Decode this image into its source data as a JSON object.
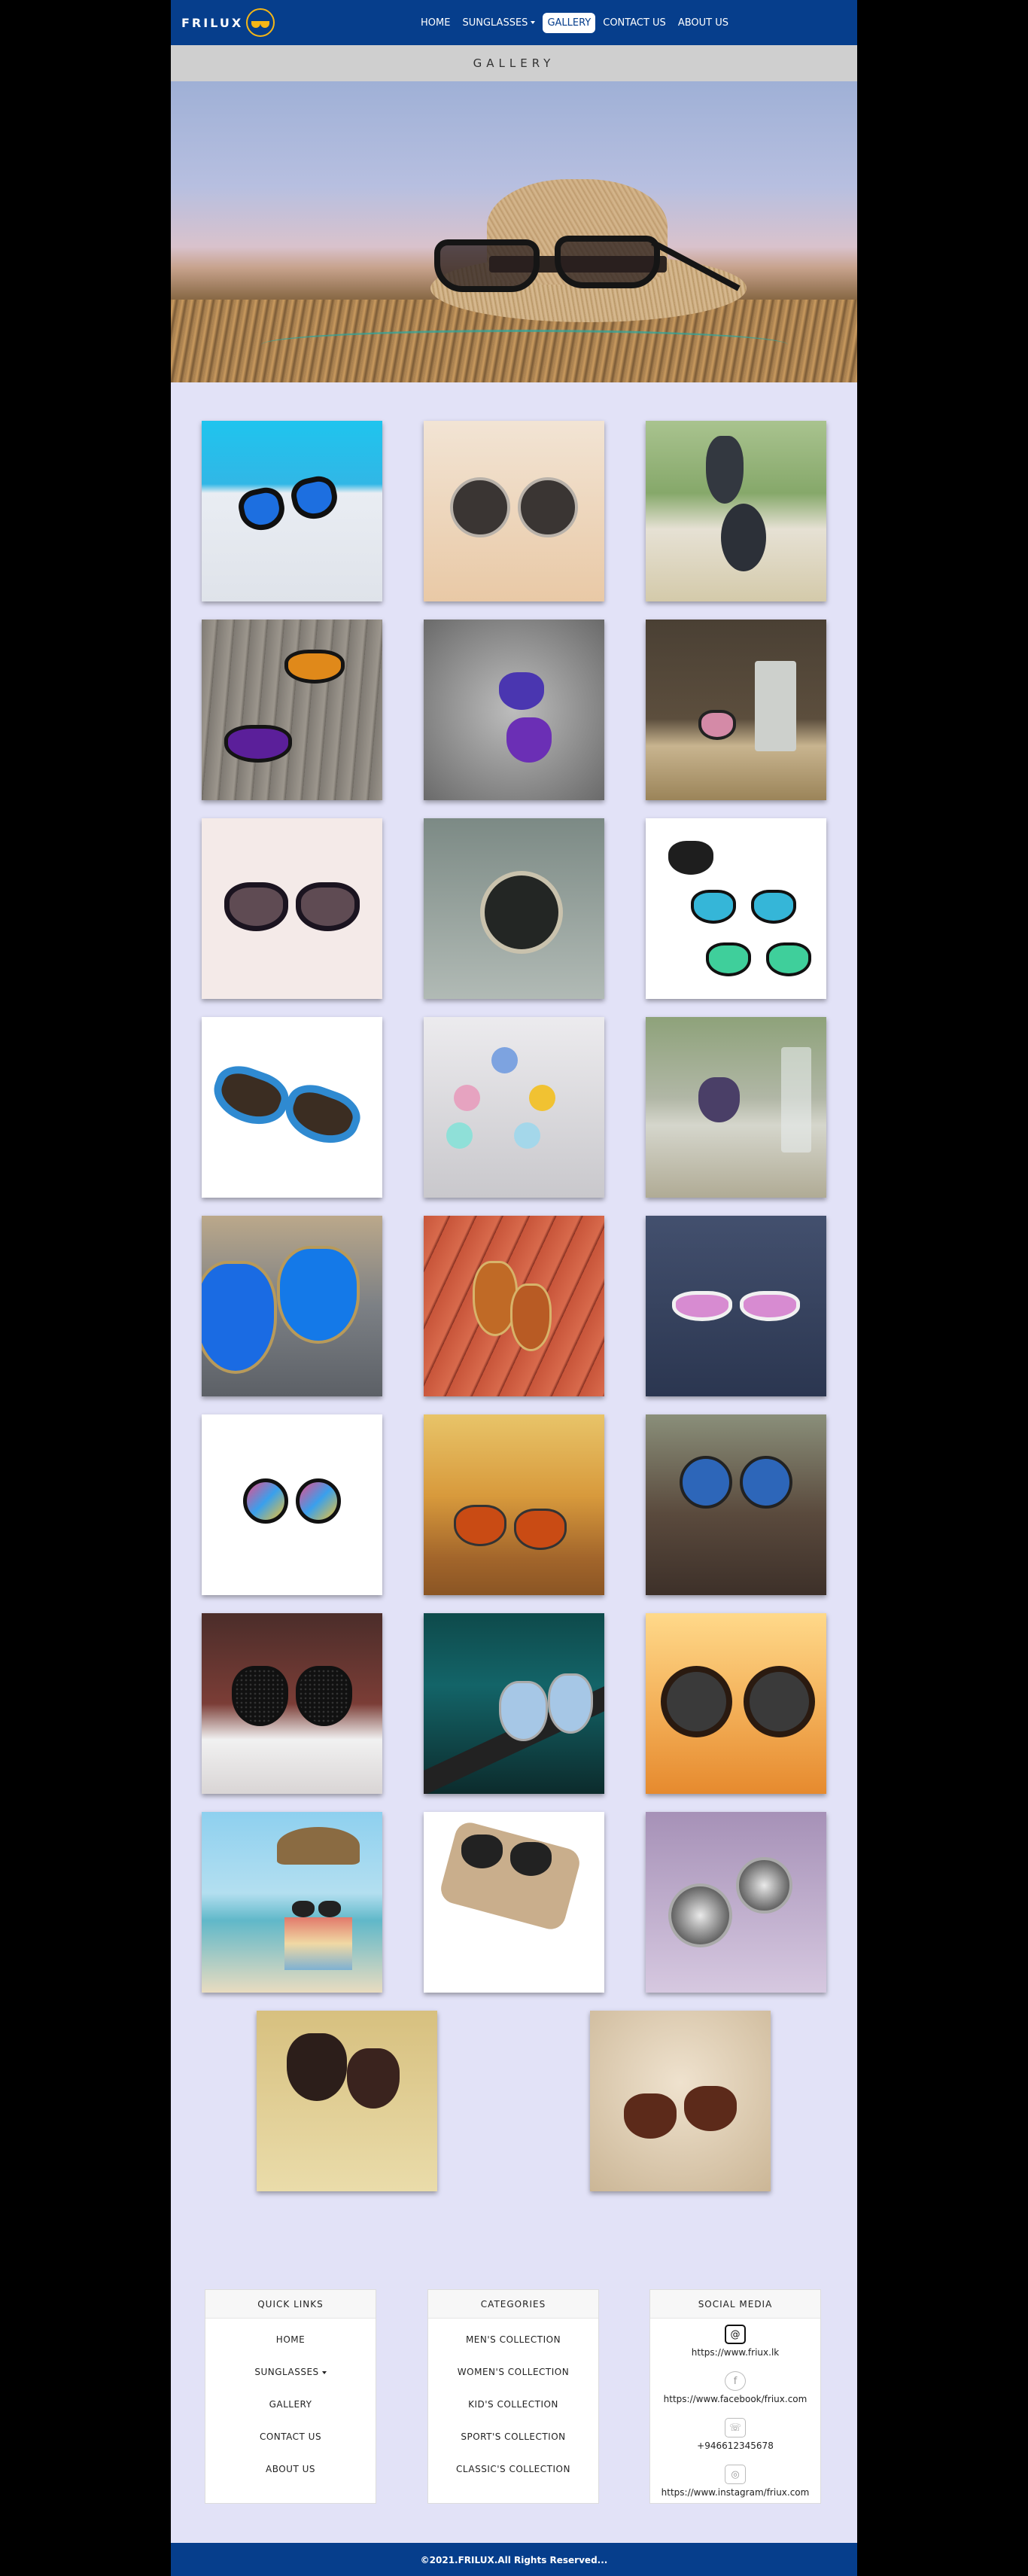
{
  "brand": {
    "name": "FRILUX",
    "accent": "#f5b616",
    "primary": "#063e8c"
  },
  "nav": {
    "items": [
      {
        "label": "HOME"
      },
      {
        "label": "SUNGLASSES"
      },
      {
        "label": "GALLERY"
      },
      {
        "label": "CONTACT US"
      },
      {
        "label": "ABOUT US"
      }
    ],
    "active": "GALLERY"
  },
  "page_title": "GALLERY",
  "hero": {
    "icon": "hat-with-sunglasses-photo"
  },
  "gallery": {
    "images": [
      "sunglasses-pool-photo",
      "round-sunglasses-photo",
      "sunglasses-on-book-photo",
      "sunglasses-on-wood-photo",
      "sunglasses-on-shells-photo",
      "sunglasses-on-table-photo",
      "dark-sunglasses-photo",
      "round-sunglasses-photo",
      "mirrored-sunglasses-photo",
      "blue-sunglasses-photo",
      "round-colored-sunglasses-photo",
      "sunglasses-by-glass-photo",
      "blue-aviator-photo",
      "sunglasses-on-red-table-photo",
      "pink-mirror-sunglasses-photo",
      "rainbow-mirror-sunglasses-photo",
      "sunset-aviator-photo",
      "blue-round-sunglasses-photo",
      "pattern-sunglasses-photo",
      "guitar-aviator-photo",
      "orange-round-sunglasses-photo",
      "beach-books-sunglasses-photo",
      "sunglasses-on-case-photo",
      "palm-reflection-sunglasses-photo",
      "sand-sunglasses-photo",
      "sand-tortoise-sunglasses-photo"
    ]
  },
  "footer": {
    "quick_links": {
      "title": "QUICK LINKS",
      "items": [
        "HOME",
        "SUNGLASSES",
        "GALLERY",
        "CONTACT US",
        "ABOUT US"
      ]
    },
    "categories": {
      "title": "CATEGORIES",
      "items": [
        "MEN'S COLLECTION",
        "WOMEN'S COLLECTION",
        "KID'S COLLECTION",
        "SPORT'S COLLECTION",
        "CLASSIC'S COLLECTION"
      ]
    },
    "social": {
      "title": "SOCIAL MEDIA",
      "items": [
        {
          "icon": "web-icon",
          "text": "https://www.friux.lk"
        },
        {
          "icon": "facebook-icon",
          "text": "https://www.facebook/friux.com"
        },
        {
          "icon": "phone-icon",
          "text": "+946612345678"
        },
        {
          "icon": "instagram-icon",
          "text": "https://www.instagram/friux.com"
        }
      ]
    },
    "copyright": "©2021.FRILUX.All Rights Reserved..."
  }
}
